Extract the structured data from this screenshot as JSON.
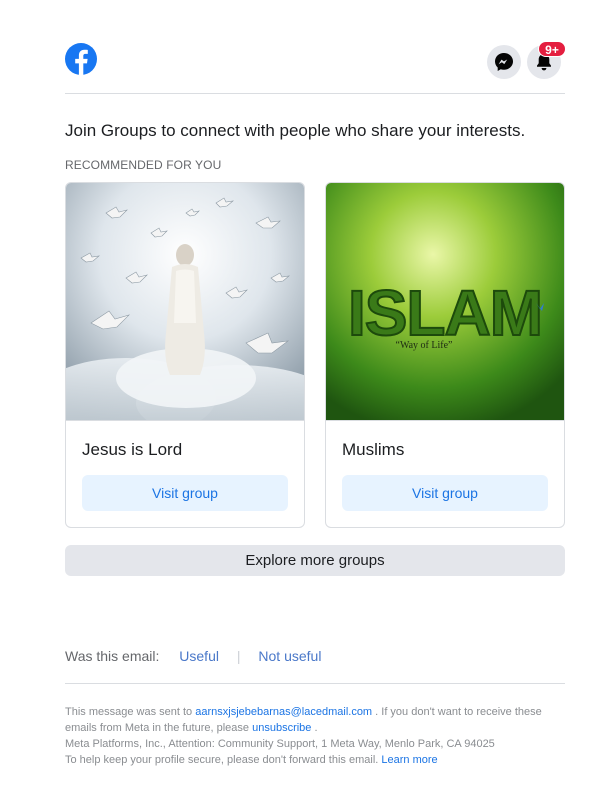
{
  "header": {
    "logo_icon": "facebook-logo-icon",
    "messenger_icon": "messenger-icon",
    "notifications_icon": "bell-icon",
    "notification_badge": "9+",
    "brand_color": "#1877f2",
    "badge_color": "#e41e3f"
  },
  "headline": "Join Groups to connect with people who share your interests.",
  "section_label": "RECOMMENDED FOR YOU",
  "groups": [
    {
      "name": "Jesus is Lord",
      "button": "Visit group",
      "image": "jesus-walking-among-doves-image"
    },
    {
      "name": "Muslims",
      "button": "Visit group",
      "image": "islam-way-of-life-image",
      "image_text": "ISLAM",
      "image_subtext": "“Way of Life”"
    }
  ],
  "explore_button": "Explore more groups",
  "feedback": {
    "question": "Was this email:",
    "useful": "Useful",
    "separator": "|",
    "not_useful": "Not useful"
  },
  "footer": {
    "sent_to_prefix": "This message was sent to",
    "email": "aarnsxjsjebebarnas@lacedmail.com",
    "sent_to_suffix": ". If you don't want to receive these emails from Meta in the future, please",
    "unsubscribe": "unsubscribe",
    "period": ".",
    "address": "Meta Platforms, Inc., Attention: Community Support, 1 Meta Way, Menlo Park, CA 94025",
    "secure_text": "To help keep your profile secure, please don't forward this email.",
    "learn_more": "Learn more"
  }
}
